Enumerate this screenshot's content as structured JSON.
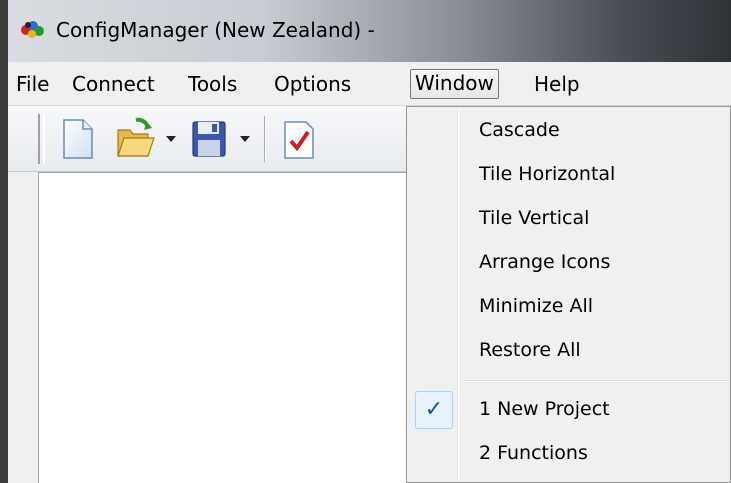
{
  "window": {
    "title": "ConfigManager (New Zealand) -",
    "app_icon": "configmanager-app-icon"
  },
  "menubar": {
    "items": [
      {
        "label": "File"
      },
      {
        "label": "Connect"
      },
      {
        "label": "Tools"
      },
      {
        "label": "Options"
      },
      {
        "label": "Window",
        "open": true
      },
      {
        "label": "Help"
      }
    ]
  },
  "toolbar": {
    "buttons": [
      {
        "icon": "new-document-icon"
      },
      {
        "icon": "open-folder-icon",
        "has_dropdown": true
      },
      {
        "icon": "save-disk-icon",
        "has_dropdown": true
      },
      {
        "icon": "check-document-icon"
      }
    ]
  },
  "window_menu": {
    "items": [
      {
        "label": "Cascade"
      },
      {
        "label": "Tile Horizontal"
      },
      {
        "label": "Tile Vertical"
      },
      {
        "label": "Arrange Icons"
      },
      {
        "label": "Minimize All"
      },
      {
        "label": "Restore All"
      }
    ],
    "windows": [
      {
        "label": "1 New Project",
        "checked": true
      },
      {
        "label": "2 Functions",
        "checked": false
      }
    ],
    "check_glyph": "✓"
  },
  "colors": {
    "highlight_border": "#6f7880",
    "check_color": "#1a4fb8"
  }
}
